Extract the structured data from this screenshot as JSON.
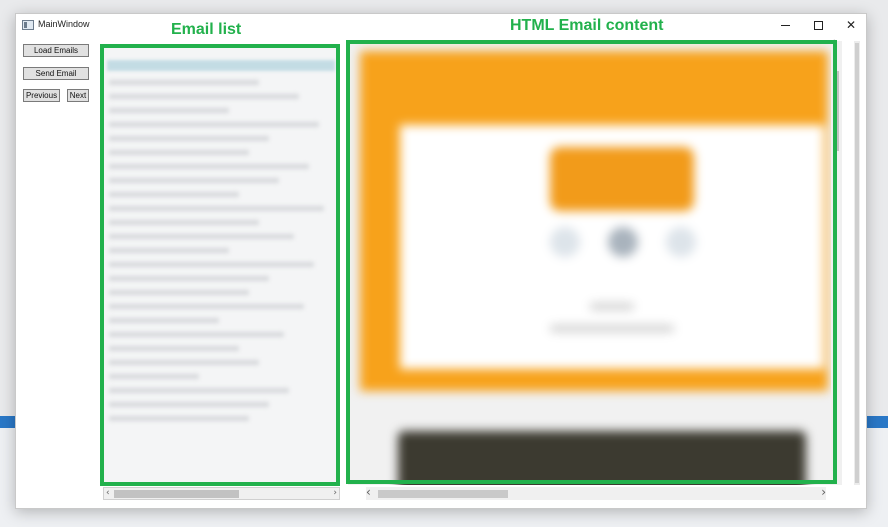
{
  "window": {
    "title": "MainWindow"
  },
  "buttons": {
    "load_emails": "Load Emails",
    "send_email": "Send Email",
    "previous": "Previous",
    "next": "Next"
  },
  "window_controls": {
    "minimize_icon": "minimize-icon",
    "maximize_icon": "maximize-icon",
    "close_glyph": "✕"
  },
  "scroll_glyphs": {
    "left": "‹",
    "right": "›",
    "up": "˄",
    "down": "˅"
  },
  "annotations": {
    "email_list_label": "Email list",
    "html_content_label": "HTML Email content"
  },
  "colors": {
    "annotation_green": "#22b14c",
    "email_orange": "#f7a21b",
    "button_face": "#e1e1e1"
  }
}
